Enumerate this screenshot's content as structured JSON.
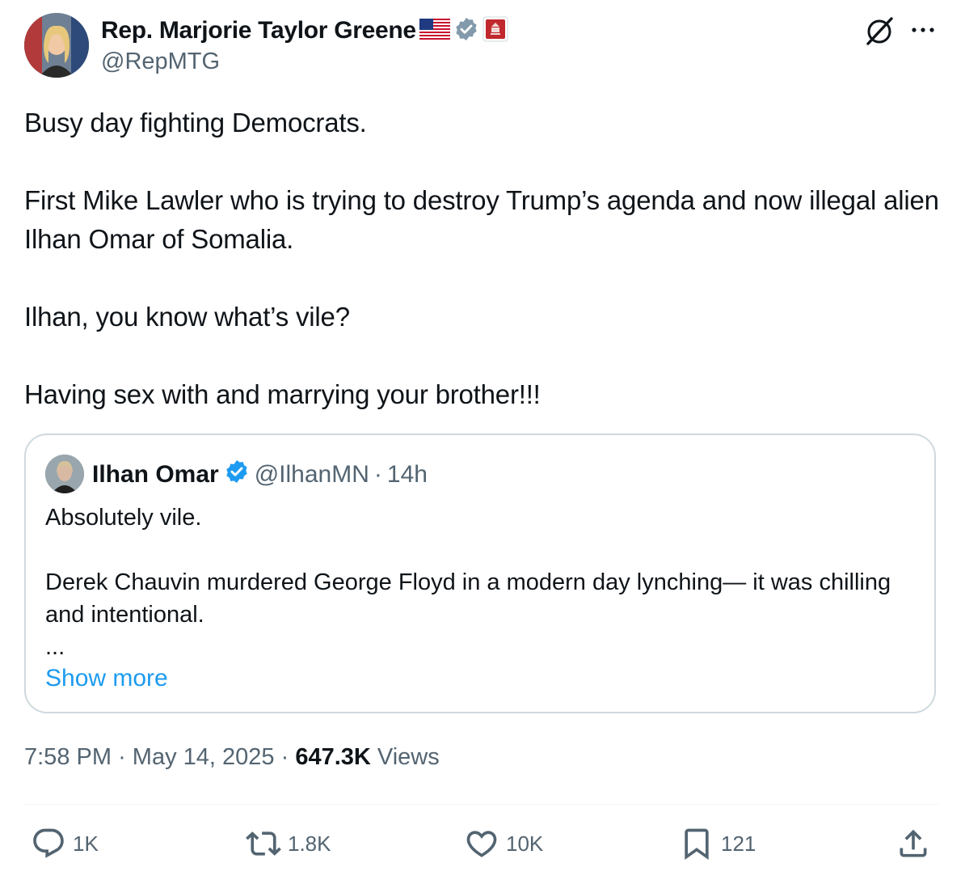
{
  "author": {
    "display_name": "Rep. Marjorie Taylor Greene",
    "handle": "@RepMTG",
    "icons": [
      "us-flag-icon",
      "verified-gray-badge-icon",
      "house-seal-icon"
    ]
  },
  "header_icons": [
    "grok-icon",
    "more-options-icon"
  ],
  "post": {
    "text": "Busy day fighting Democrats.\n\nFirst Mike Lawler who is trying to destroy Trump’s agenda and now illegal alien Ilhan Omar of Somalia.\n\nIlhan, you know what’s vile?\n\nHaving sex with and marrying your brother!!!"
  },
  "quote": {
    "name": "Ilhan Omar",
    "handle": "@IlhanMN",
    "separator": "·",
    "time": "14h",
    "text": "Absolutely vile.\n\nDerek Chauvin murdered George Floyd in a modern day lynching— it was chilling and intentional.\n...",
    "show_more": "Show more"
  },
  "meta": {
    "time": "7:58 PM",
    "sep1": "·",
    "date": "May 14, 2025",
    "sep2": "·",
    "views_count": "647.3K",
    "views_label": "Views"
  },
  "actions": {
    "replies": "1K",
    "reposts": "1.8K",
    "likes": "10K",
    "bookmarks": "121"
  },
  "colors": {
    "text": "#0f1419",
    "secondary": "#536471",
    "link": "#1d9bf0",
    "border": "#cfd9de",
    "verified_blue": "#1d9bf0",
    "verified_gray": "#829aab"
  }
}
